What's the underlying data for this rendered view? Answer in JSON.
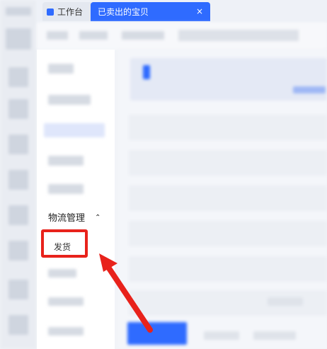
{
  "tabs": {
    "workbench_label": "工作台",
    "sold_items_label": "已卖出的宝贝",
    "close_glyph": "×"
  },
  "menu": {
    "section_title": "物流管理",
    "section_caret": "⌃",
    "ship_item_label": "发货"
  },
  "colors": {
    "accent": "#2f6bff",
    "highlight": "#e8221b"
  }
}
